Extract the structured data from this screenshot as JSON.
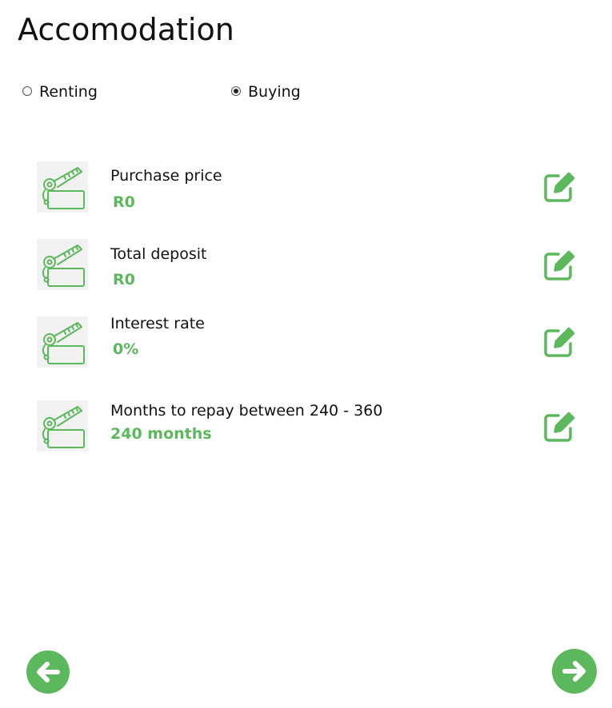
{
  "page": {
    "title": "Accomodation"
  },
  "colors": {
    "accent": "#5cb85c",
    "icon_bg": "#f2f2f2",
    "text": "#111111"
  },
  "mode": {
    "options": [
      {
        "label": "Renting",
        "selected": false
      },
      {
        "label": "Buying",
        "selected": true
      }
    ]
  },
  "fields": [
    {
      "label": "Purchase price",
      "value": "R0",
      "icon": "key-tag-icon",
      "action_icon": "edit-icon"
    },
    {
      "label": "Total deposit",
      "value": "R0",
      "icon": "key-tag-icon",
      "action_icon": "edit-icon"
    },
    {
      "label": "Interest rate",
      "value": "0%",
      "icon": "key-tag-icon",
      "action_icon": "edit-icon"
    },
    {
      "label": "Months to repay between 240 - 360",
      "value": "240 months",
      "icon": "key-tag-icon",
      "action_icon": "edit-icon"
    }
  ],
  "navigation": {
    "back_icon": "arrow-left-icon",
    "next_icon": "arrow-right-icon"
  }
}
